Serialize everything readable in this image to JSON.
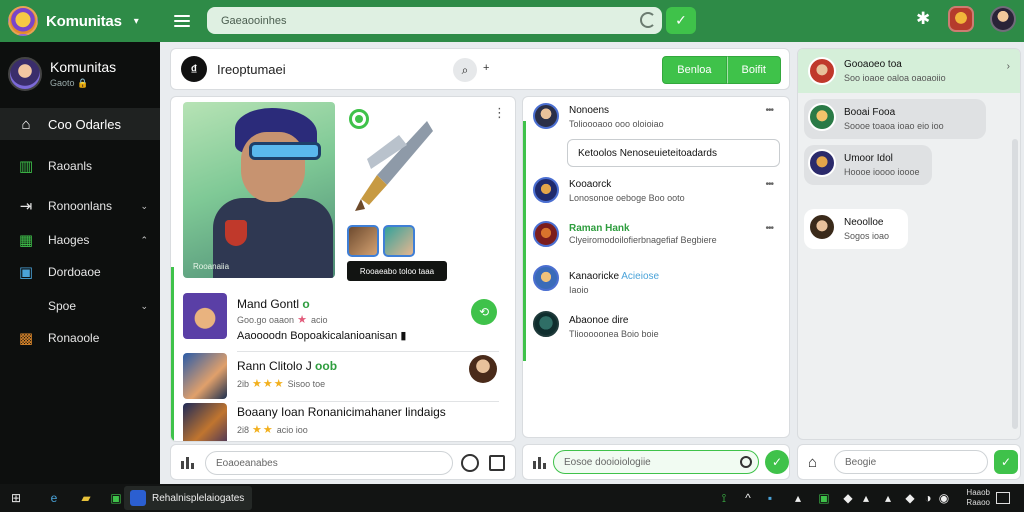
{
  "app": {
    "brand": "Komunitas",
    "search_placeholder": "Gaeaooinhes",
    "colors": {
      "primary_green": "#2e8b47",
      "accent_green": "#3fc24a",
      "sidebar_bg": "#0d0f0e"
    }
  },
  "sidebar": {
    "profile_name": "Komunitas",
    "profile_status": "Gaoto",
    "items": [
      {
        "label": "Coo Odarles",
        "icon": "home-icon"
      },
      {
        "label": "Raoanls",
        "icon": "chart-icon"
      },
      {
        "label": "Ronoonlans",
        "icon": "arrow-icon"
      },
      {
        "label": "Haoges",
        "icon": "image-icon"
      },
      {
        "label": "Dordoaoe",
        "icon": "document-icon"
      },
      {
        "label": "Spoe",
        "icon": ""
      },
      {
        "label": "Ronaoole",
        "icon": "game-icon"
      }
    ]
  },
  "header": {
    "title": "Ireoptumaei",
    "btn_left": "Benloa",
    "btn_right": "Boifit"
  },
  "feed": {
    "hero_caption": "Rooanaiia",
    "hero_tag": "Rooaeabo toloo taaa",
    "posts": [
      {
        "title": "Mand Gontl",
        "title_accent": "o",
        "meta": "Goo.go oaaon",
        "stars": "★",
        "meta2": "acio",
        "desc": "Aaoooodn Bopoakicalanioanisan"
      },
      {
        "title": "Rann Clitolo J",
        "title_accent": "oob",
        "meta": "2ib",
        "stars": "★★★",
        "meta2": "Sisoo toe"
      },
      {
        "title": "Boaany Ioan Ronanicimahaner lindaigs",
        "meta": "2i8",
        "stars": "★★",
        "meta2": "acio ioo"
      }
    ],
    "composer_placeholder": "Eoaoeanabes"
  },
  "chat": {
    "rows": [
      {
        "name": "Nonoens",
        "sub": "Tolioooaoo ooo oloioiao"
      },
      {
        "name": "Kooaorck",
        "sub": "Lonosonoe oeboge Boo ooto"
      },
      {
        "name": "Raman",
        "name_accent": "Hank",
        "sub": "Clyeiromodoilofierbnagefiaf Begbiere"
      },
      {
        "name": "Kanaoricke",
        "name_accent": "Acieiose",
        "sub": "Iaoio"
      },
      {
        "name": "Abaonoe dire",
        "sub": "Tliooooonea Boio boie"
      }
    ],
    "bubble": "Ketoolos Nenoseuieteitoadards",
    "composer_placeholder": "Eosoe dooioiologiie"
  },
  "right": {
    "head_name": "Gooaoeo toa",
    "head_sub": "Soo ioaoe oaloa oaoaoiio",
    "rows": [
      {
        "name": "Booai Fooa",
        "sub": "Soooe toaoa ioao eio ioo"
      },
      {
        "name": "Umoor Idol",
        "sub": "Hoooe ioooo ioooe"
      },
      {
        "name": "Neoolloe",
        "sub": "Sogos ioao"
      }
    ],
    "composer_placeholder": "Beogie"
  },
  "taskbar": {
    "active_label": "Rehalnisplelaiogates",
    "clock_time": "Haaob",
    "clock_date": "Raaoo"
  }
}
